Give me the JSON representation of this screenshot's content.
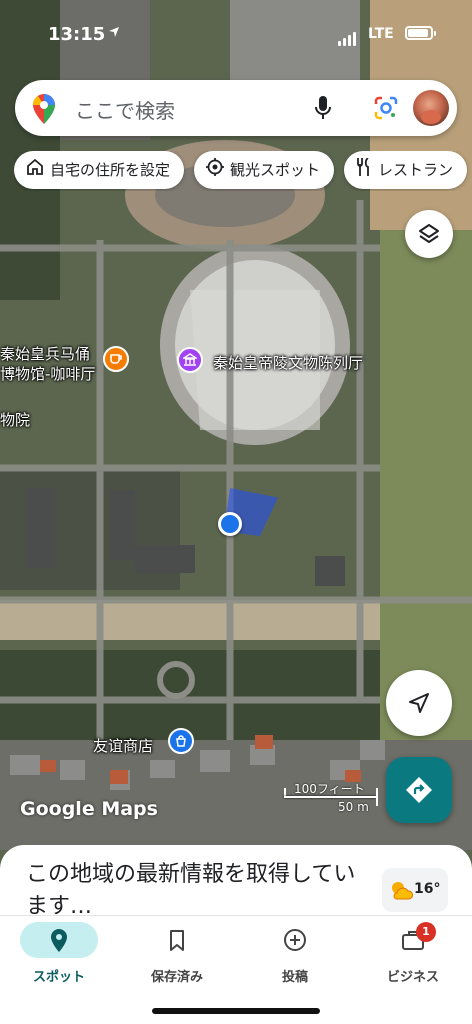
{
  "status_bar": {
    "time": "13:15",
    "network": "LTE"
  },
  "search": {
    "placeholder": "ここで検索"
  },
  "chips": [
    {
      "label": "自宅の住所を設定",
      "icon": "home-icon"
    },
    {
      "label": "観光スポット",
      "icon": "attraction-icon"
    },
    {
      "label": "レストラン",
      "icon": "restaurant-icon"
    }
  ],
  "map": {
    "pois": [
      {
        "label": "秦始皇兵马俑\n博物馆-咖啡厅",
        "icon": "cafe-icon",
        "color": "#f57c00"
      },
      {
        "label": "秦始皇帝陵文物陈列厅",
        "icon": "museum-icon",
        "color": "#a142f4"
      },
      {
        "label": "物院"
      },
      {
        "label": "友谊商店",
        "icon": "shopping-icon",
        "color": "#1a73e8"
      }
    ],
    "watermark": "Google Maps",
    "scale": {
      "imperial": "100フィート",
      "metric": "50 m"
    }
  },
  "sheet": {
    "title": "この地域の最新情報を取得しています…"
  },
  "weather": {
    "temp": "16°",
    "icon": "sun-cloud-icon"
  },
  "tabs": [
    {
      "label": "スポット",
      "icon": "explore-pin-icon",
      "active": true
    },
    {
      "label": "保存済み",
      "icon": "bookmark-icon"
    },
    {
      "label": "投稿",
      "icon": "add-circle-icon"
    },
    {
      "label": "ビジネス",
      "icon": "briefcase-icon",
      "badge": "1"
    }
  ],
  "colors": {
    "accent": "#0b7a80",
    "active_tab_bg": "#c4eef0",
    "badge": "#d93025",
    "my_location": "#1a73e8"
  }
}
